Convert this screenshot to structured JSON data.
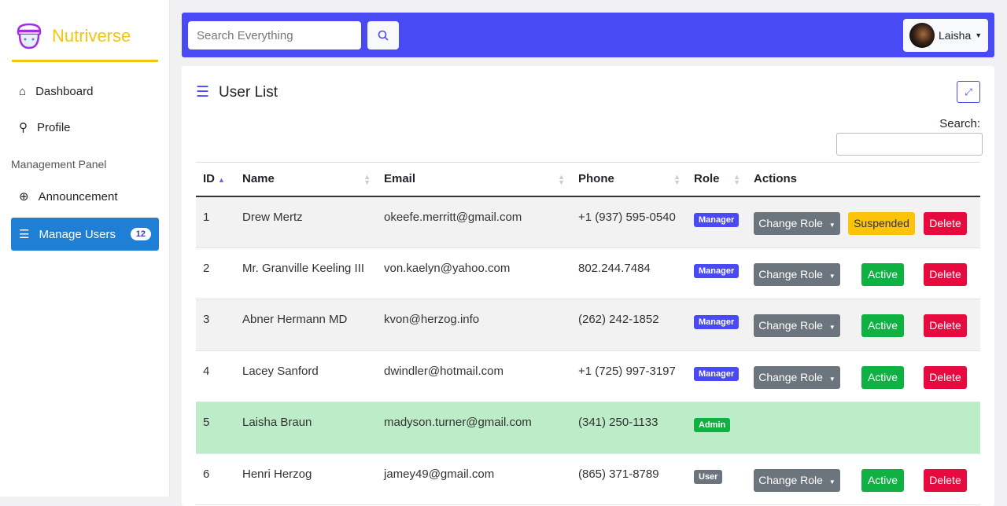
{
  "brand": {
    "name": "Nutriverse"
  },
  "sidebar": {
    "items": [
      {
        "label": "Dashboard",
        "icon": "home-icon"
      },
      {
        "label": "Profile",
        "icon": "user-icon"
      }
    ],
    "section": "Management Panel",
    "management": [
      {
        "label": "Announcement",
        "icon": "plus-circle-icon"
      },
      {
        "label": "Manage Users",
        "icon": "list-icon",
        "badge": "12",
        "active": true
      }
    ]
  },
  "topbar": {
    "search_placeholder": "Search Everything",
    "user_name": "Laisha"
  },
  "card": {
    "title": "User List",
    "search_label": "Search:"
  },
  "table": {
    "headers": [
      "ID",
      "Name",
      "Email",
      "Phone",
      "Role",
      "Actions"
    ],
    "rows": [
      {
        "id": "1",
        "name": "Drew Mertz",
        "email": "okeefe.merritt@gmail.com",
        "phone": "+1 (937) 595-0540",
        "role": "Manager",
        "change": "Change Role",
        "status": "Suspended",
        "delete": "Delete"
      },
      {
        "id": "2",
        "name": "Mr. Granville Keeling III",
        "email": "von.kaelyn@yahoo.com",
        "phone": "802.244.7484",
        "role": "Manager",
        "change": "Change Role",
        "status": "Active",
        "delete": "Delete"
      },
      {
        "id": "3",
        "name": "Abner Hermann MD",
        "email": "kvon@herzog.info",
        "phone": "(262) 242-1852",
        "role": "Manager",
        "change": "Change Role",
        "status": "Active",
        "delete": "Delete"
      },
      {
        "id": "4",
        "name": "Lacey Sanford",
        "email": "dwindler@hotmail.com",
        "phone": "+1 (725) 997-3197",
        "role": "Manager",
        "change": "Change Role",
        "status": "Active",
        "delete": "Delete"
      },
      {
        "id": "5",
        "name": "Laisha Braun",
        "email": "madyson.turner@gmail.com",
        "phone": "(341) 250-1133",
        "role": "Admin"
      },
      {
        "id": "6",
        "name": "Henri Herzog",
        "email": "jamey49@gmail.com",
        "phone": "(865) 371-8789",
        "role": "User",
        "change": "Change Role",
        "status": "Active",
        "delete": "Delete"
      }
    ]
  },
  "colors": {
    "primary": "#4a4af4",
    "brand": "#f2c511",
    "manager": "#4a4af4",
    "admin": "#10b143",
    "user": "#6c757d",
    "active": "#10b143",
    "suspended": "#fbc409",
    "delete": "#e70a3f",
    "sidebar_active": "#1f7fd4"
  }
}
